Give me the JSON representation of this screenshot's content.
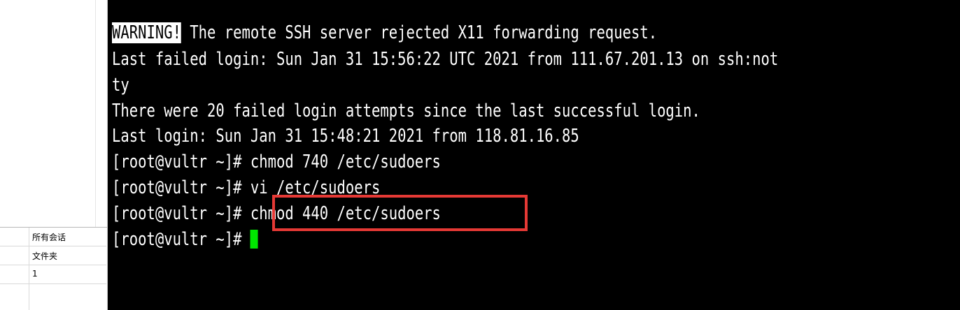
{
  "sidebar": {
    "properties": [
      {
        "value": "所有会话"
      },
      {
        "value": "文件夹"
      },
      {
        "value": "1"
      }
    ]
  },
  "terminal": {
    "warning_label": "WARNING!",
    "warning_text": " The remote SSH server rejected X11 forwarding request.",
    "lines": [
      "Last failed login: Sun Jan 31 15:56:22 UTC 2021 from 111.67.201.13 on ssh:not",
      "ty",
      "There were 20 failed login attempts since the last successful login.",
      "Last login: Sun Jan 31 15:48:21 2021 from 118.81.16.85",
      "[root@vultr ~]# chmod 740 /etc/sudoers",
      "[root@vultr ~]# vi /etc/sudoers",
      "[root@vultr ~]# chmod 440 /etc/sudoers"
    ],
    "prompt": "[root@vultr ~]# ",
    "cursor_color": "#00e600",
    "highlight_color": "#e53935"
  }
}
